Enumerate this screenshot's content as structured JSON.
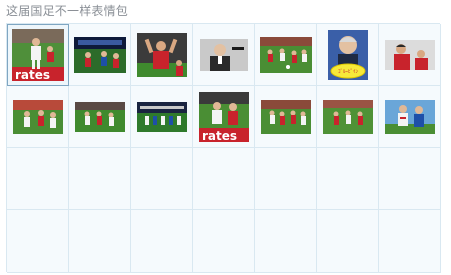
{
  "panel": {
    "title": "这届国足不一样表情包"
  },
  "stickers": [
    {
      "id": "s1",
      "scene": "pitch-players",
      "selected": true,
      "overlay_text": "rates"
    },
    {
      "id": "s2",
      "scene": "stadium-banner"
    },
    {
      "id": "s3",
      "scene": "red-jersey-celebration"
    },
    {
      "id": "s4",
      "scene": "coach-portrait"
    },
    {
      "id": "s5",
      "scene": "pitch-action"
    },
    {
      "id": "s6",
      "scene": "coach-speech-bubble",
      "overlay_text": "ｺﾞﾙｰﾋﾟｲﾝ"
    },
    {
      "id": "s7",
      "scene": "red-jersey-player"
    },
    {
      "id": "s8",
      "scene": "pitch-action"
    },
    {
      "id": "s9",
      "scene": "pitch-players"
    },
    {
      "id": "s10",
      "scene": "stadium-banner"
    },
    {
      "id": "s11",
      "scene": "pitch-players",
      "overlay_text": "rates"
    },
    {
      "id": "s12",
      "scene": "pitch-action"
    },
    {
      "id": "s13",
      "scene": "pitch-action"
    },
    {
      "id": "s14",
      "scene": "blue-white-duel"
    }
  ],
  "colors": {
    "grid_line": "#d9e8f1",
    "grid_bg": "#f5fafd",
    "title": "#8a8f96",
    "pitch": "#3f8a2e",
    "red_jersey": "#c8232c",
    "white_jersey": "#f2f2f2"
  }
}
